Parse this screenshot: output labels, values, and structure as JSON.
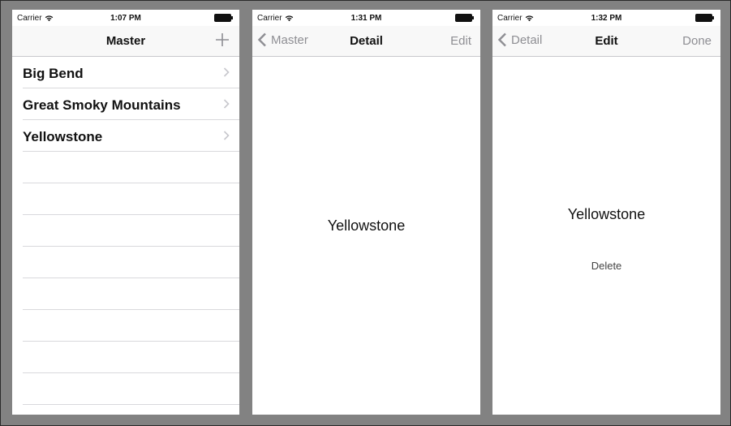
{
  "screens": [
    {
      "status": {
        "carrier": "Carrier",
        "time": "1:07 PM"
      },
      "nav": {
        "title": "Master",
        "right_icon": "plus-icon"
      },
      "rows": [
        {
          "label": "Big Bend"
        },
        {
          "label": "Great Smoky Mountains"
        },
        {
          "label": "Yellowstone"
        }
      ]
    },
    {
      "status": {
        "carrier": "Carrier",
        "time": "1:31 PM"
      },
      "nav": {
        "back_label": "Master",
        "title": "Detail",
        "right_label": "Edit"
      },
      "content": {
        "park_name": "Yellowstone"
      }
    },
    {
      "status": {
        "carrier": "Carrier",
        "time": "1:32 PM"
      },
      "nav": {
        "back_label": "Detail",
        "title": "Edit",
        "right_label": "Done"
      },
      "content": {
        "park_name": "Yellowstone",
        "delete_label": "Delete"
      }
    }
  ],
  "colors": {
    "frame_bg": "#828282",
    "nav_inactive": "#8e8e93",
    "separator": "#d9d9dc"
  }
}
